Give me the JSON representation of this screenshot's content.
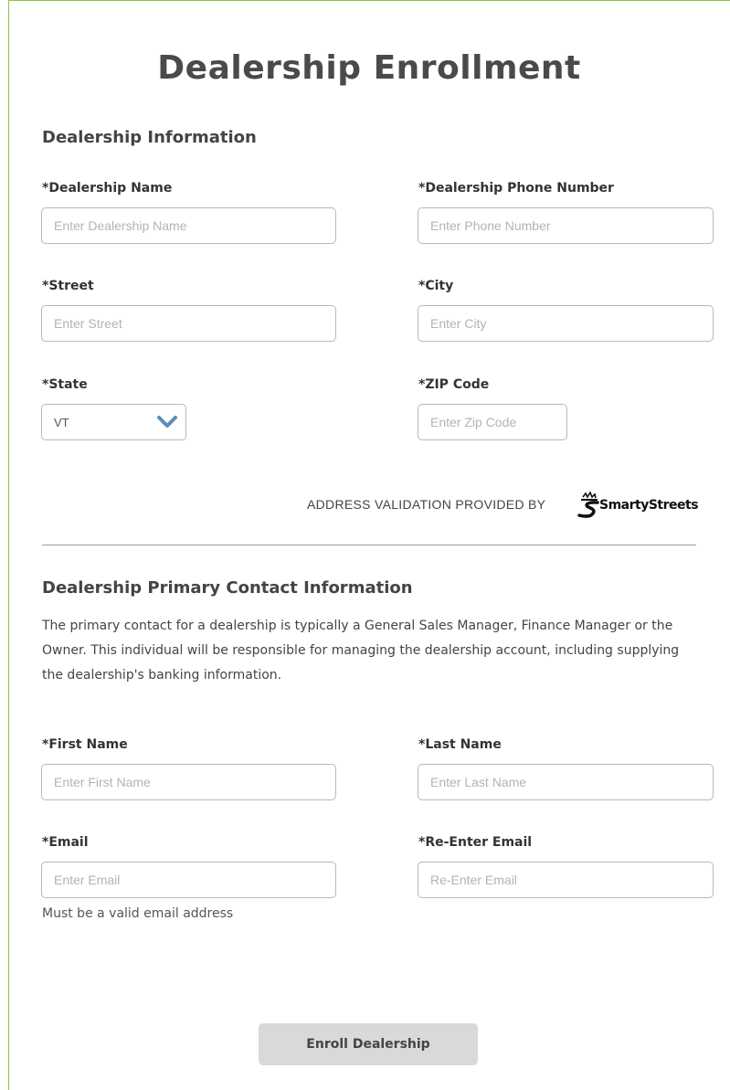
{
  "page": {
    "title": "Dealership Enrollment"
  },
  "dealership": {
    "section_title": "Dealership Information",
    "name": {
      "label": "*Dealership Name",
      "placeholder": "Enter Dealership Name"
    },
    "phone": {
      "label": "*Dealership Phone Number",
      "placeholder": "Enter Phone Number"
    },
    "street": {
      "label": "*Street",
      "placeholder": "Enter Street"
    },
    "city": {
      "label": "*City",
      "placeholder": "Enter City"
    },
    "state": {
      "label": "*State",
      "value": "VT"
    },
    "zip": {
      "label": "*ZIP Code",
      "placeholder": "Enter Zip Code"
    },
    "validation_text": "ADDRESS VALIDATION PROVIDED BY",
    "validation_logo_text": "SmartyStreets"
  },
  "contact": {
    "section_title": "Dealership Primary Contact Information",
    "description": "The primary contact for a dealership is typically a General Sales Manager, Finance Manager or the Owner. This individual will be responsible for managing the dealership account, including supplying the dealership's banking information.",
    "first_name": {
      "label": "*First Name",
      "placeholder": "Enter First Name"
    },
    "last_name": {
      "label": "*Last Name",
      "placeholder": "Enter Last Name"
    },
    "email": {
      "label": "*Email",
      "placeholder": "Enter Email",
      "help": "Must be a valid email address"
    },
    "reenter_email": {
      "label": "*Re-Enter Email",
      "placeholder": "Re-Enter Email"
    }
  },
  "actions": {
    "submit_label": "Enroll Dealership"
  },
  "colors": {
    "frame_border": "#8cc63f",
    "chevron": "#5b8db8",
    "button_bg": "#d9d9d9"
  },
  "icons": {
    "state_dropdown": "chevron-down-icon",
    "validation_logo": "smartystreets-logo"
  }
}
